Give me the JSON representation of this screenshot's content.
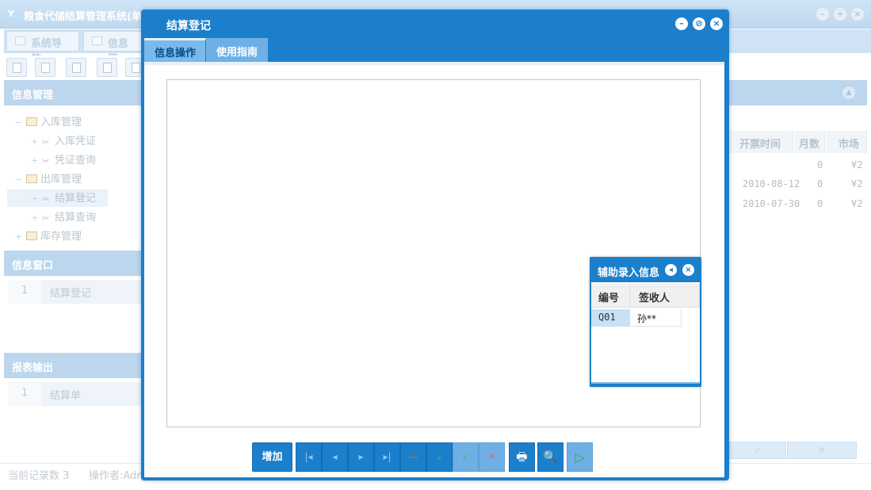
{
  "app": {
    "title": "粮食代储结算管理系统(单",
    "logo_text": "Y"
  },
  "bg_tabs": [
    {
      "label": "系统导航",
      "icon": "window-icon"
    },
    {
      "label": "信息管",
      "icon": "grid-icon"
    }
  ],
  "sidebar": {
    "info_management": {
      "header": "信息管理",
      "tree": [
        {
          "label": "入库管理",
          "icon": "folder-icon"
        },
        {
          "label": "入库凭证",
          "icon": "tool-icon"
        },
        {
          "label": "凭证查询",
          "icon": "tool-icon"
        },
        {
          "label": "出库管理",
          "icon": "folder-icon"
        },
        {
          "label": "结算登记",
          "icon": "tool-icon"
        },
        {
          "label": "结算查询",
          "icon": "tool-icon"
        },
        {
          "label": "库存管理",
          "icon": "folder-icon"
        }
      ]
    },
    "info_window": {
      "header": "信息窗口",
      "items": [
        {
          "num": "1",
          "label": "结算登记"
        }
      ]
    },
    "report_output": {
      "header": "报表输出",
      "items": [
        {
          "num": "1",
          "label": "结算单"
        }
      ]
    }
  },
  "bg_grid": {
    "columns": [
      "开票时间",
      "月数",
      "市场"
    ],
    "rows": [
      {
        "date": "",
        "months": "0",
        "price": "¥2"
      },
      {
        "date": "2010-08-12",
        "months": "0",
        "price": "¥2"
      },
      {
        "date": "2010-07-30",
        "months": "0",
        "price": "¥2"
      }
    ]
  },
  "status_bar": {
    "record_count": "当前记录数 3",
    "operator": "操作者:Adm"
  },
  "modal": {
    "title": "结算登记",
    "tabs": [
      {
        "label": "信息操作",
        "active": true
      },
      {
        "label": "使用指南",
        "active": false
      }
    ],
    "toolbar": {
      "add_label": "增加",
      "buttons": [
        {
          "name": "first-button",
          "glyph": "|◂"
        },
        {
          "name": "prev-button",
          "glyph": "◂"
        },
        {
          "name": "next-button",
          "glyph": "▸"
        },
        {
          "name": "last-button",
          "glyph": "▸|"
        },
        {
          "name": "remove-button",
          "glyph": "—"
        },
        {
          "name": "up-button",
          "glyph": "▴"
        },
        {
          "name": "confirm-button",
          "glyph": "✓"
        },
        {
          "name": "cancel-button",
          "glyph": "✕"
        },
        {
          "name": "print-button",
          "glyph": "🖶"
        },
        {
          "name": "print-preview-button",
          "glyph": "🔍"
        },
        {
          "name": "run-button",
          "glyph": "▷"
        }
      ]
    }
  },
  "helper": {
    "title": "辅助录入信息",
    "columns": [
      "编号",
      "签收人"
    ],
    "rows": [
      {
        "id": "Q01",
        "signer": "孙**"
      }
    ]
  },
  "colors": {
    "modal_blue": "#1b7fcc",
    "tab_blue": "#6eb0e6",
    "bg_header": "#bcd6ee"
  }
}
